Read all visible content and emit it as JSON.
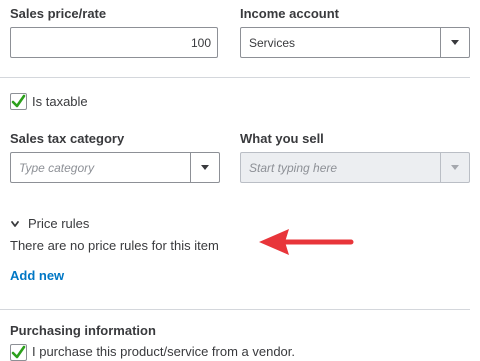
{
  "pricing": {
    "sales_price_label": "Sales price/rate",
    "sales_price_value": "100",
    "income_account_label": "Income account",
    "income_account_value": "Services"
  },
  "tax": {
    "is_taxable_label": "Is taxable",
    "is_taxable_checked": true,
    "sales_tax_category_label": "Sales tax category",
    "sales_tax_category_placeholder": "Type category",
    "what_you_sell_label": "What you sell",
    "what_you_sell_placeholder": "Start typing here"
  },
  "price_rules": {
    "title": "Price rules",
    "empty_message": "There are no price rules for this item",
    "add_new_label": "Add new"
  },
  "purchasing": {
    "title": "Purchasing information",
    "vendor_checkbox_label": "I purchase this product/service from a vendor.",
    "vendor_checked": true
  },
  "colors": {
    "checkbox_green": "#2ca01c",
    "link_blue": "#0077c5",
    "annotation_red": "#e8353a"
  },
  "icons": [
    "checkmark-icon",
    "chevron-down-icon",
    "chevron-right-icon",
    "red-arrow-annotation"
  ]
}
